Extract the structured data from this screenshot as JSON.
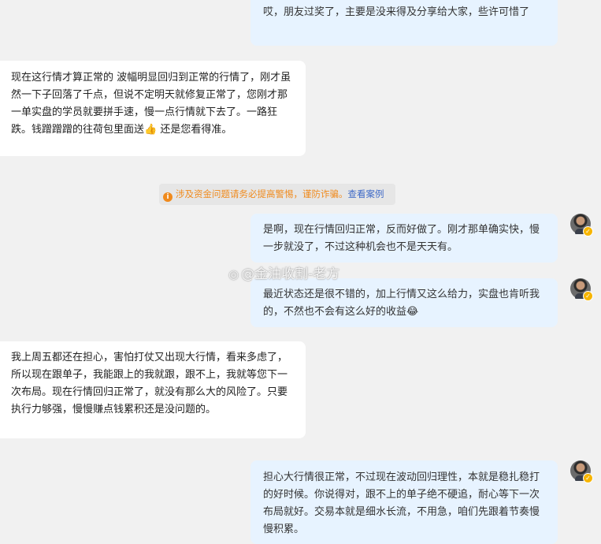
{
  "messages": [
    {
      "side": "out",
      "text": "哎，朋友过奖了，主要是没来得及分享给大家，些许可惜了"
    },
    {
      "side": "in",
      "text": "现在这行情才算正常的 波幅明显回归到正常的行情了，刚才虽然一下子回落了千点，但说不定明天就修复正常了，您刚才那一单实盘的学员就要拼手速，慢一点行情就下去了。一路狂跌。钱蹭蹭蹭的往荷包里面送👍 还是您看得准。"
    },
    {
      "side": "out",
      "text": "是啊，现在行情回归正常，反而好做了。刚才那单确实快，慢一步就没了，不过这种机会也不是天天有。"
    },
    {
      "side": "out",
      "text": "最近状态还是很不错的，加上行情又这么给力，实盘也肯听我的，不然也不会有这么好的收益😂"
    },
    {
      "side": "in",
      "text": "我上周五都还在担心，害怕打仗又出现大行情，看来多虑了，所以现在跟单子，我能跟上的我就跟，跟不上，我就等您下一次布局。现在行情回归正常了，就没有那么大的风险了。只要执行力够强，慢慢赚点钱累积还是没问题的。"
    },
    {
      "side": "out",
      "text": "担心大行情很正常，不过现在波动回归理性，本就是稳扎稳打的好时候。你说得对，跟不上的单子绝不硬追，耐心等下一次布局就好。交易本就是细水长流，不用急，咱们先跟着节奏慢慢积累。"
    }
  ],
  "notice": {
    "icon": "info-icon",
    "text": "涉及资金问题请务必提高警惕，谨防诈骗。",
    "link": "查看案例"
  },
  "watermark": {
    "icon": "weibo-icon",
    "text": "@金油收割-老方"
  },
  "colors": {
    "background": "#f1f1f1",
    "outgoing_bubble": "#e7f3ff",
    "incoming_bubble": "#ffffff",
    "notice_text": "#f08a1c",
    "notice_link": "#3f6ac7",
    "verified_badge": "#f7b500"
  }
}
